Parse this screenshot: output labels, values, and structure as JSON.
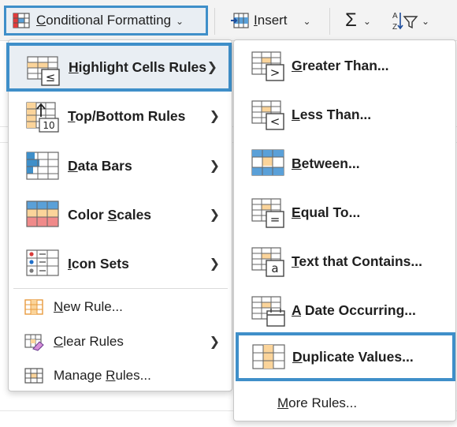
{
  "ribbon": {
    "conditional_formatting": {
      "pre": "",
      "ul": "C",
      "post": "onditional Formatting"
    },
    "insert": {
      "pre": "",
      "ul": "I",
      "post": "nsert"
    },
    "sum_icon": "sigma-icon",
    "sort_icon": "sort-filter-icon"
  },
  "main_menu": {
    "items": [
      {
        "pre": "",
        "ul": "H",
        "post": "ighlight Cells Rules",
        "icon": "highlight-cells-icon",
        "submenu": true
      },
      {
        "pre": "",
        "ul": "T",
        "post": "op/Bottom Rules",
        "icon": "top-bottom-icon",
        "submenu": true
      },
      {
        "pre": "",
        "ul": "D",
        "post": "ata Bars",
        "icon": "data-bars-icon",
        "submenu": true
      },
      {
        "pre": "Color ",
        "ul": "S",
        "post": "cales",
        "icon": "color-scales-icon",
        "submenu": true
      },
      {
        "pre": "",
        "ul": "I",
        "post": "con Sets",
        "icon": "icon-sets-icon",
        "submenu": true
      }
    ],
    "small_items": [
      {
        "pre": "",
        "ul": "N",
        "post": "ew Rule...",
        "icon": "new-rule-icon",
        "submenu": false
      },
      {
        "pre": "",
        "ul": "C",
        "post": "lear Rules",
        "icon": "clear-rules-icon",
        "submenu": true
      },
      {
        "pre": "Manage ",
        "ul": "R",
        "post": "ules...",
        "icon": "manage-rules-icon",
        "submenu": false
      }
    ]
  },
  "sub_menu": {
    "items": [
      {
        "pre": "",
        "ul": "G",
        "post": "reater Than...",
        "icon": "greater-than-icon"
      },
      {
        "pre": "",
        "ul": "L",
        "post": "ess Than...",
        "icon": "less-than-icon"
      },
      {
        "pre": "",
        "ul": "B",
        "post": "etween...",
        "icon": "between-icon"
      },
      {
        "pre": "",
        "ul": "E",
        "post": "qual To...",
        "icon": "equal-to-icon"
      },
      {
        "pre": "",
        "ul": "T",
        "post": "ext that Contains...",
        "icon": "text-contains-icon"
      },
      {
        "pre": "",
        "ul": "A",
        "post": " Date Occurring...",
        "icon": "date-occurring-icon"
      },
      {
        "pre": "",
        "ul": "D",
        "post": "uplicate Values...",
        "icon": "duplicate-values-icon"
      }
    ],
    "more_rules": {
      "pre": "",
      "ul": "M",
      "post": "ore Rules..."
    }
  },
  "colors": {
    "accent": "#3f8fc9",
    "cell_fill": "#fbd49a",
    "cell_border": "#e89b3e"
  }
}
